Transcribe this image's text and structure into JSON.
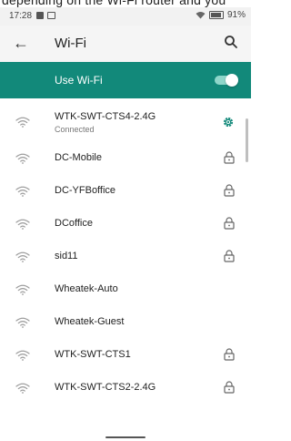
{
  "top_clip": {
    "text": "depending on the Wi-Fi router and you"
  },
  "status_bar": {
    "time": "17:28",
    "battery": "91%"
  },
  "toolbar": {
    "title": "Wi-Fi"
  },
  "master_switch": {
    "label": "Use Wi-Fi",
    "state": "on"
  },
  "networks": [
    {
      "name": "WTK-SWT-CTS4-2.4G",
      "status": "Connected",
      "trailing": "gear-icon"
    },
    {
      "name": "DC-Mobile",
      "trailing": "lock-icon"
    },
    {
      "name": "DC-YFBoffice",
      "trailing": "lock-icon"
    },
    {
      "name": "DCoffice",
      "trailing": "lock-icon"
    },
    {
      "name": "sid11",
      "trailing": "lock-icon"
    },
    {
      "name": "Wheatek-Auto",
      "trailing": ""
    },
    {
      "name": "Wheatek-Guest",
      "trailing": ""
    },
    {
      "name": "WTK-SWT-CTS1",
      "trailing": "lock-icon"
    },
    {
      "name": "WTK-SWT-CTS2-2.4G",
      "trailing": "lock-icon"
    }
  ],
  "colors": {
    "accent": "#12897a",
    "gear": "#12897a",
    "icon_gray": "#9e9e9e"
  }
}
